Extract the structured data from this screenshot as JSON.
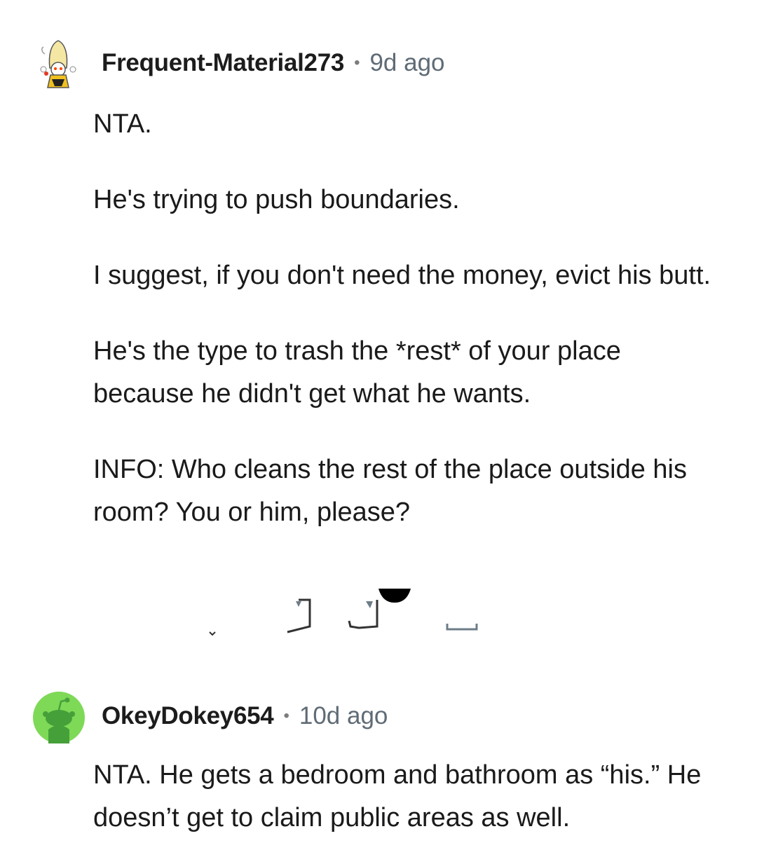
{
  "comments": [
    {
      "username": "Frequent-Material273",
      "time": "9d ago",
      "avatar_icon": "banana-snoo-avatar-icon",
      "paragraphs": [
        "NTA.",
        "He's trying to push boundaries.",
        "I suggest, if you don't need the money, evict his butt.",
        "He's the type to trash the *rest* of your place because he didn't get what he wants.",
        "INFO: Who cleans the rest of the place outside his room? You or him, please?"
      ]
    },
    {
      "username": "OkeyDokey654",
      "time": "10d ago",
      "avatar_icon": "green-snoo-avatar-icon",
      "paragraphs": [
        "NTA. He gets a bedroom and bathroom as “his.” He doesn’t get to claim public areas as well."
      ]
    }
  ],
  "action_icons": [
    "reply-icon",
    "upvote-icon",
    "downvote-icon",
    "more-icon"
  ],
  "colors": {
    "avatar_green": "#7ed957",
    "snoo_dark_green": "#46a03a",
    "separator": "#7c7c7c",
    "timestamp": "#5f6b75"
  }
}
